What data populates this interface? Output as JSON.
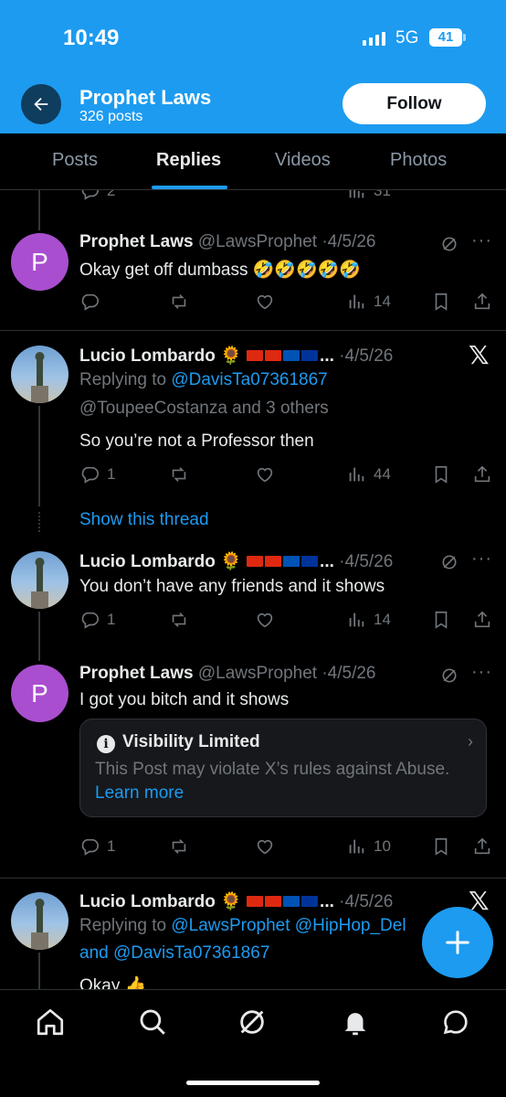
{
  "status_bar": {
    "time": "10:49",
    "network": "5G",
    "battery": "41"
  },
  "header": {
    "profile_name": "Prophet Laws",
    "post_count": "326 posts",
    "follow_label": "Follow"
  },
  "tabs": [
    {
      "label": "Posts"
    },
    {
      "label": "Replies"
    },
    {
      "label": "Videos"
    },
    {
      "label": "Photos"
    }
  ],
  "partial_top": {
    "replies": "2",
    "views": "31"
  },
  "tweets": [
    {
      "avatar_letter": "P",
      "name": "Prophet Laws",
      "handle": "@LawsProphet",
      "date": "4/5/26",
      "text": "Okay get off dumbass 🤣🤣🤣🤣🤣",
      "replies": "",
      "views": "14"
    },
    {
      "name": "Lucio Lombardo 🌻",
      "ellipsis": "...",
      "date": "4/5/26",
      "replying_prefix": "Replying to",
      "replying_to_1": "@DavisTa07361867",
      "replying_to_2": "@ToupeeCostanza and 3 others",
      "text": "So you’re not a Professor then",
      "replies": "1",
      "views": "44"
    },
    {
      "show_thread": "Show this thread",
      "name": "Lucio Lombardo 🌻",
      "ellipsis": "...",
      "date": "4/5/26",
      "text": "You don’t have any friends and it shows",
      "replies": "1",
      "views": "14"
    },
    {
      "avatar_letter": "P",
      "name": "Prophet Laws",
      "handle": "@LawsProphet",
      "date": "4/5/26",
      "text": "I got you bitch and it shows",
      "visibility_title": "Visibility Limited",
      "visibility_body": "This Post may violate X’s rules against Abuse.",
      "visibility_link": "Learn more",
      "replies": "1",
      "views": "10"
    },
    {
      "name": "Lucio Lombardo 🌻",
      "ellipsis": "...",
      "date": "4/5/26",
      "replying_prefix": "Replying to",
      "replying_to_1": "@LawsProphet @HipHop_Del",
      "replying_to_2_prefix": "and",
      "replying_to_2": "@DavisTa07361867",
      "text": "Okay 👍"
    }
  ],
  "flag_colors": [
    "#de2910",
    "#de2910",
    "#0052b4",
    "#f2c200",
    "#003399"
  ],
  "accent": "#1d9bf0",
  "nav": [
    "home-icon",
    "search-icon",
    "grok-icon",
    "notifications-icon",
    "messages-icon"
  ]
}
